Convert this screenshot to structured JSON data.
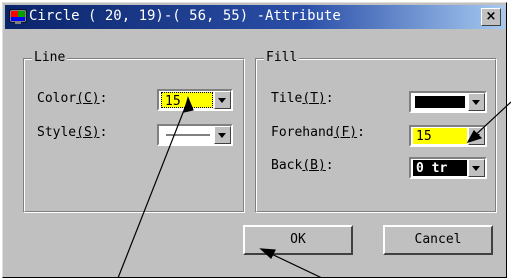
{
  "dialog": {
    "title": "Circle ( 20, 19)-( 56, 55) -Attribute",
    "close_label": "×"
  },
  "line_group": {
    "legend": "Line",
    "color_label_pre": "Color",
    "color_label_key": "(C)",
    "color_label_post": ":",
    "color_value": "15",
    "style_label_pre": "Style",
    "style_label_key": "(S)",
    "style_label_post": ":"
  },
  "fill_group": {
    "legend": "Fill",
    "tile_label_pre": "Tile",
    "tile_label_key": "(T)",
    "tile_label_post": ":",
    "forehand_label_pre": "Forehand",
    "forehand_label_key": "(F)",
    "forehand_label_post": ":",
    "forehand_value": "15",
    "back_label_pre": "Back",
    "back_label_key": "(B)",
    "back_label_post": ":",
    "back_value": "0 tr"
  },
  "buttons": {
    "ok_label": "OK",
    "cancel_label": "Cancel"
  },
  "colors": {
    "title_bar": "#0a246a",
    "highlight_yellow": "#ffff00",
    "dialog_face": "#c0c0c0"
  }
}
